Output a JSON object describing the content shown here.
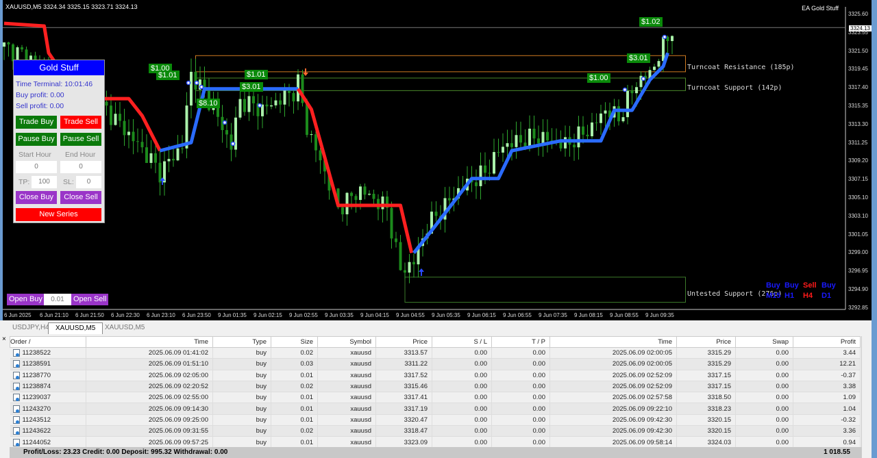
{
  "chart": {
    "header": "XAUUSD,M5  3324.34 3325.15 3323.71 3324.13",
    "ea_label": "EA Gold Stuff",
    "current_price": "3324.13",
    "y_ticks": [
      "3325.60",
      "3323.55",
      "3321.50",
      "3319.45",
      "3317.40",
      "3315.35",
      "3313.30",
      "3311.25",
      "3309.20",
      "3307.15",
      "3305.10",
      "3303.10",
      "3301.05",
      "3299.00",
      "3296.95",
      "3294.90",
      "3292.85"
    ],
    "x_ticks": [
      "6 Jun 2025",
      "6 Jun 21:10",
      "6 Jun 21:50",
      "6 Jun 22:30",
      "6 Jun 23:10",
      "6 Jun 23:50",
      "9 Jun 01:35",
      "9 Jun 02:15",
      "9 Jun 02:55",
      "9 Jun 03:35",
      "9 Jun 04:15",
      "9 Jun 04:55",
      "9 Jun 05:35",
      "9 Jun 06:15",
      "9 Jun 06:55",
      "9 Jun 07:35",
      "9 Jun 08:15",
      "9 Jun 08:55",
      "9 Jun 09:35"
    ],
    "price_path": [
      [
        0,
        3322
      ],
      [
        9,
        3320
      ],
      [
        17,
        3316
      ],
      [
        23,
        3315
      ],
      [
        32,
        3310
      ],
      [
        35,
        3308
      ],
      [
        40,
        3311
      ],
      [
        42,
        3319
      ],
      [
        46,
        3316
      ],
      [
        51,
        3311
      ],
      [
        53,
        3316
      ],
      [
        58,
        3315
      ],
      [
        65,
        3317
      ],
      [
        66,
        3318
      ],
      [
        68,
        3313
      ],
      [
        72,
        3308
      ],
      [
        75,
        3304
      ],
      [
        80,
        3306
      ],
      [
        86,
        3304
      ],
      [
        89,
        3297
      ],
      [
        92,
        3298
      ],
      [
        95,
        3302
      ],
      [
        102,
        3306
      ],
      [
        108,
        3308
      ],
      [
        112,
        3311
      ],
      [
        120,
        3312
      ],
      [
        126,
        3311
      ],
      [
        132,
        3313
      ],
      [
        135,
        3315
      ],
      [
        138,
        3314
      ],
      [
        142,
        3318
      ],
      [
        145,
        3319
      ],
      [
        148,
        3322
      ],
      [
        150,
        3324
      ]
    ],
    "trend": [
      {
        "color": "#ff2020",
        "pts": [
          [
            0,
            3324.6
          ],
          [
            9,
            3324.3
          ],
          [
            10,
            3321.3
          ],
          [
            17,
            3316.2
          ],
          [
            28,
            3316.2
          ],
          [
            31,
            3314.3
          ],
          [
            35,
            3310.4
          ]
        ]
      },
      {
        "color": "#2a6bff",
        "pts": [
          [
            35,
            3310.4
          ],
          [
            42,
            3311.3
          ],
          [
            45,
            3317.3
          ],
          [
            66,
            3317.3
          ]
        ]
      },
      {
        "color": "#ff2020",
        "pts": [
          [
            66,
            3317.3
          ],
          [
            69,
            3315
          ],
          [
            75,
            3304.3
          ],
          [
            89,
            3304.3
          ],
          [
            91.5,
            3299
          ]
        ]
      },
      {
        "color": "#2a6bff",
        "pts": [
          [
            92,
            3299
          ],
          [
            96,
            3301.5
          ],
          [
            105,
            3307.3
          ],
          [
            111,
            3307.3
          ],
          [
            114,
            3310.4
          ],
          [
            125,
            3311.5
          ],
          [
            134,
            3311.5
          ],
          [
            137,
            3314.9
          ],
          [
            141,
            3314.9
          ],
          [
            145,
            3318.3
          ],
          [
            148,
            3319.8
          ],
          [
            149,
            3321.3
          ]
        ]
      }
    ],
    "zones": [
      {
        "label": "Turncoat Resistance (185p)",
        "color": "#d07a20",
        "from_bar": 43,
        "to_bar": 153,
        "top": 3321.0,
        "bottom": 3319.2
      },
      {
        "label": "Turncoat Support (142p)",
        "color": "#4c8a2a",
        "from_bar": 43,
        "to_bar": 153,
        "top": 3318.5,
        "bottom": 3317.1
      },
      {
        "label": "Untested Support (276p)",
        "color": "#3c7a2a",
        "from_bar": 90,
        "to_bar": 153,
        "top": 3296.3,
        "bottom": 3293.5
      }
    ],
    "profit_labels": [
      "$1.00",
      "$1.01",
      "$8.10",
      "$1.01",
      "$3.01",
      "$1.00",
      "$3.01",
      "$1.02"
    ],
    "mtf": {
      "signals": [
        {
          "label": "Buy",
          "tf": "M15",
          "color": "#1a1aff"
        },
        {
          "label": "Buy",
          "tf": "H1",
          "color": "#1a1aff"
        },
        {
          "label": "Sell",
          "tf": "H4",
          "color": "#ff1a1a"
        },
        {
          "label": "Buy",
          "tf": "D1",
          "color": "#1a1aff"
        }
      ]
    }
  },
  "panel": {
    "title": "Gold Stuff",
    "time_terminal": "Time Terminal: 10:01:46",
    "buy_profit": "Buy profit: 0.00",
    "sell_profit": "Sell profit: 0.00",
    "trade_buy": "Trade Buy",
    "trade_sell": "Trade Sell",
    "pause_buy": "Pause Buy",
    "pause_sell": "Pause Sell",
    "start_hour_label": "Start Hour",
    "end_hour_label": "End Hour",
    "start_hour": "0",
    "end_hour": "0",
    "tp_label": "TP:",
    "tp": "100",
    "sl_label": "SL:",
    "sl": "0",
    "close_buy": "Close Buy",
    "close_sell": "Close Sell",
    "new_series": "New Series",
    "open_buy": "Open Buy",
    "lot": "0.01",
    "open_sell": "Open Sell"
  },
  "tabs": [
    "USDJPY,H4",
    "XAUUSD,M5",
    "XAUUSD,M5"
  ],
  "table": {
    "headers": [
      "Order  /",
      "Time",
      "Type",
      "Size",
      "Symbol",
      "Price",
      "S / L",
      "T / P",
      "Time",
      "Price",
      "Swap",
      "Profit"
    ],
    "rows": [
      [
        "11238522",
        "2025.06.09 01:41:02",
        "buy",
        "0.02",
        "xauusd",
        "3313.57",
        "0.00",
        "0.00",
        "2025.06.09 02:00:05",
        "3315.29",
        "0.00",
        "3.44"
      ],
      [
        "11238591",
        "2025.06.09 01:51:10",
        "buy",
        "0.03",
        "xauusd",
        "3311.22",
        "0.00",
        "0.00",
        "2025.06.09 02:00:05",
        "3315.29",
        "0.00",
        "12.21"
      ],
      [
        "11238770",
        "2025.06.09 02:05:00",
        "buy",
        "0.01",
        "xauusd",
        "3317.52",
        "0.00",
        "0.00",
        "2025.06.09 02:52:09",
        "3317.15",
        "0.00",
        "-0.37"
      ],
      [
        "11238874",
        "2025.06.09 02:20:52",
        "buy",
        "0.02",
        "xauusd",
        "3315.46",
        "0.00",
        "0.00",
        "2025.06.09 02:52:09",
        "3317.15",
        "0.00",
        "3.38"
      ],
      [
        "11239037",
        "2025.06.09 02:55:00",
        "buy",
        "0.01",
        "xauusd",
        "3317.41",
        "0.00",
        "0.00",
        "2025.06.09 02:57:58",
        "3318.50",
        "0.00",
        "1.09"
      ],
      [
        "11243270",
        "2025.06.09 09:14:30",
        "buy",
        "0.01",
        "xauusd",
        "3317.19",
        "0.00",
        "0.00",
        "2025.06.09 09:22:10",
        "3318.23",
        "0.00",
        "1.04"
      ],
      [
        "11243512",
        "2025.06.09 09:25:00",
        "buy",
        "0.01",
        "xauusd",
        "3320.47",
        "0.00",
        "0.00",
        "2025.06.09 09:42:30",
        "3320.15",
        "0.00",
        "-0.32"
      ],
      [
        "11243622",
        "2025.06.09 09:31:55",
        "buy",
        "0.02",
        "xauusd",
        "3318.47",
        "0.00",
        "0.00",
        "2025.06.09 09:42:30",
        "3320.15",
        "0.00",
        "3.36"
      ],
      [
        "11244052",
        "2025.06.09 09:57:25",
        "buy",
        "0.01",
        "xauusd",
        "3323.09",
        "0.00",
        "0.00",
        "2025.06.09 09:58:14",
        "3324.03",
        "0.00",
        "0.94"
      ]
    ]
  },
  "status": {
    "summary": "Profit/Loss: 23.23  Credit: 0.00  Deposit: 995.32  Withdrawal: 0.00",
    "total": "1 018.55"
  }
}
